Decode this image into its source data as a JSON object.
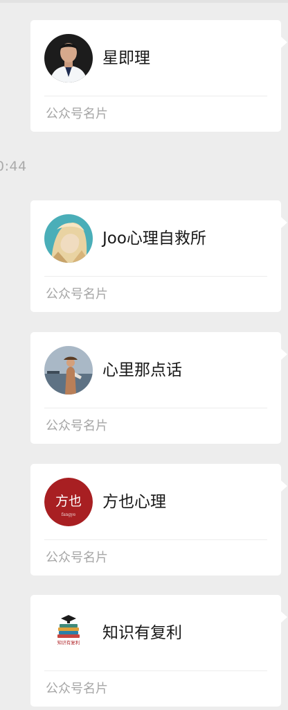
{
  "chat": {
    "timestamp": "0:44",
    "cards": [
      {
        "name": "星即理",
        "label": "公众号名片",
        "avatar_icon": "person-portrait-avatar"
      },
      {
        "name": "Joo心理自救所",
        "label": "公众号名片",
        "avatar_icon": "illustrated-girl-avatar"
      },
      {
        "name": "心里那点话",
        "label": "公众号名片",
        "avatar_icon": "seaside-photo-avatar"
      },
      {
        "name": "方也心理",
        "label": "公众号名片",
        "avatar_icon": "red-seal-logo-avatar",
        "logo_text": "方也",
        "logo_subtext": "fangye",
        "logo_color": "#a81f22"
      },
      {
        "name": "知识有复利",
        "label": "公众号名片",
        "avatar_icon": "books-logo-avatar",
        "logo_text": "知识有复利"
      }
    ]
  }
}
